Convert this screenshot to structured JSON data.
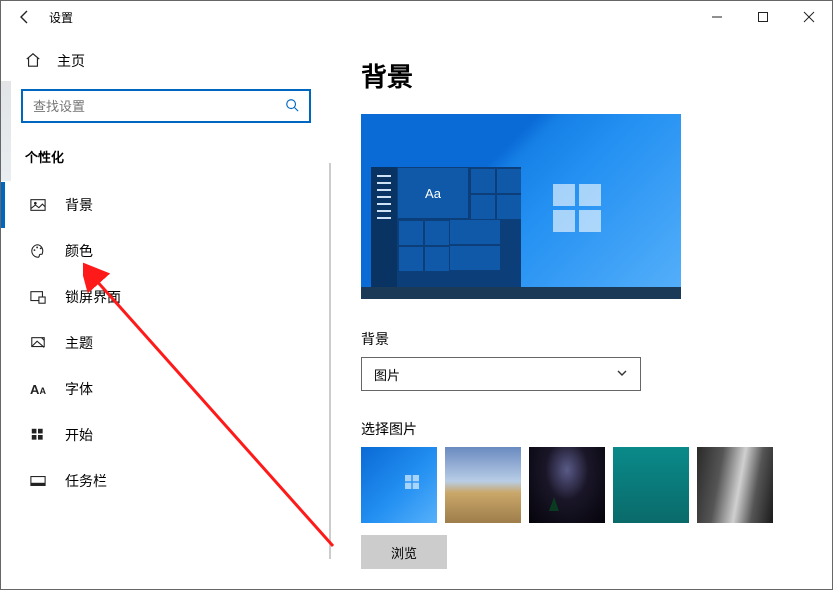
{
  "titlebar": {
    "title": "设置"
  },
  "sidebar": {
    "home": "主页",
    "search_placeholder": "查找设置",
    "section": "个性化",
    "items": [
      {
        "label": "背景"
      },
      {
        "label": "颜色"
      },
      {
        "label": "锁屏界面"
      },
      {
        "label": "主题"
      },
      {
        "label": "字体"
      },
      {
        "label": "开始"
      },
      {
        "label": "任务栏"
      }
    ]
  },
  "content": {
    "heading": "背景",
    "preview_sample_text": "Aa",
    "dropdown_label": "背景",
    "dropdown_value": "图片",
    "choose_label": "选择图片",
    "browse_label": "浏览"
  }
}
